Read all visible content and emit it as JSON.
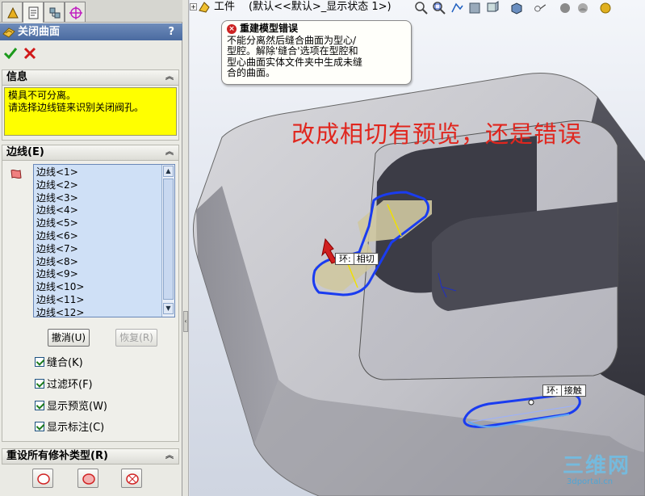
{
  "panel": {
    "title": "关闭曲面",
    "help": "?",
    "info": {
      "header": "信息",
      "message": "模具不可分离。\n请选择边线链来识别关闭阀孔。"
    },
    "edges": {
      "header": "边线(E)",
      "items": [
        "边线<1>",
        "边线<2>",
        "边线<3>",
        "边线<4>",
        "边线<5>",
        "边线<6>",
        "边线<7>",
        "边线<8>",
        "边线<9>",
        "边线<10>",
        "边线<11>",
        "边线<12>"
      ],
      "undo_label": "撤消(U)",
      "redo_label": "恢复(R)"
    },
    "options": [
      {
        "label": "缝合(K)",
        "checked": true
      },
      {
        "label": "过滤环(F)",
        "checked": true
      },
      {
        "label": "显示预览(W)",
        "checked": true
      },
      {
        "label": "显示标注(C)",
        "checked": true
      }
    ],
    "reset": {
      "header": "重设所有修补类型(R)"
    }
  },
  "viewport": {
    "tree": {
      "expand": "+",
      "part_name": "工件",
      "config": "(默认<<默认>_显示状态 1>)"
    },
    "error": {
      "title": "重建模型错误",
      "body": "不能分离然后缝合曲面为型心/\n型腔。解除'缝合'选项在型腔和\n型心曲面实体文件夹中生成未缝\n合的曲面。"
    },
    "annotation": "改成相切有预览，还是错误",
    "label_tangent": {
      "key": "环:",
      "value": "相切"
    },
    "label_contact": {
      "key": "环:",
      "value": "接触"
    },
    "watermark": {
      "big": "三维网",
      "small": "3dportal.cn"
    }
  },
  "colors": {
    "title_bar": "#4a6aa0",
    "info_bg": "#ffff00",
    "annotation": "#e0261e",
    "selected_edge": "#1a3cf0",
    "list_bg": "#cfe0f6"
  }
}
